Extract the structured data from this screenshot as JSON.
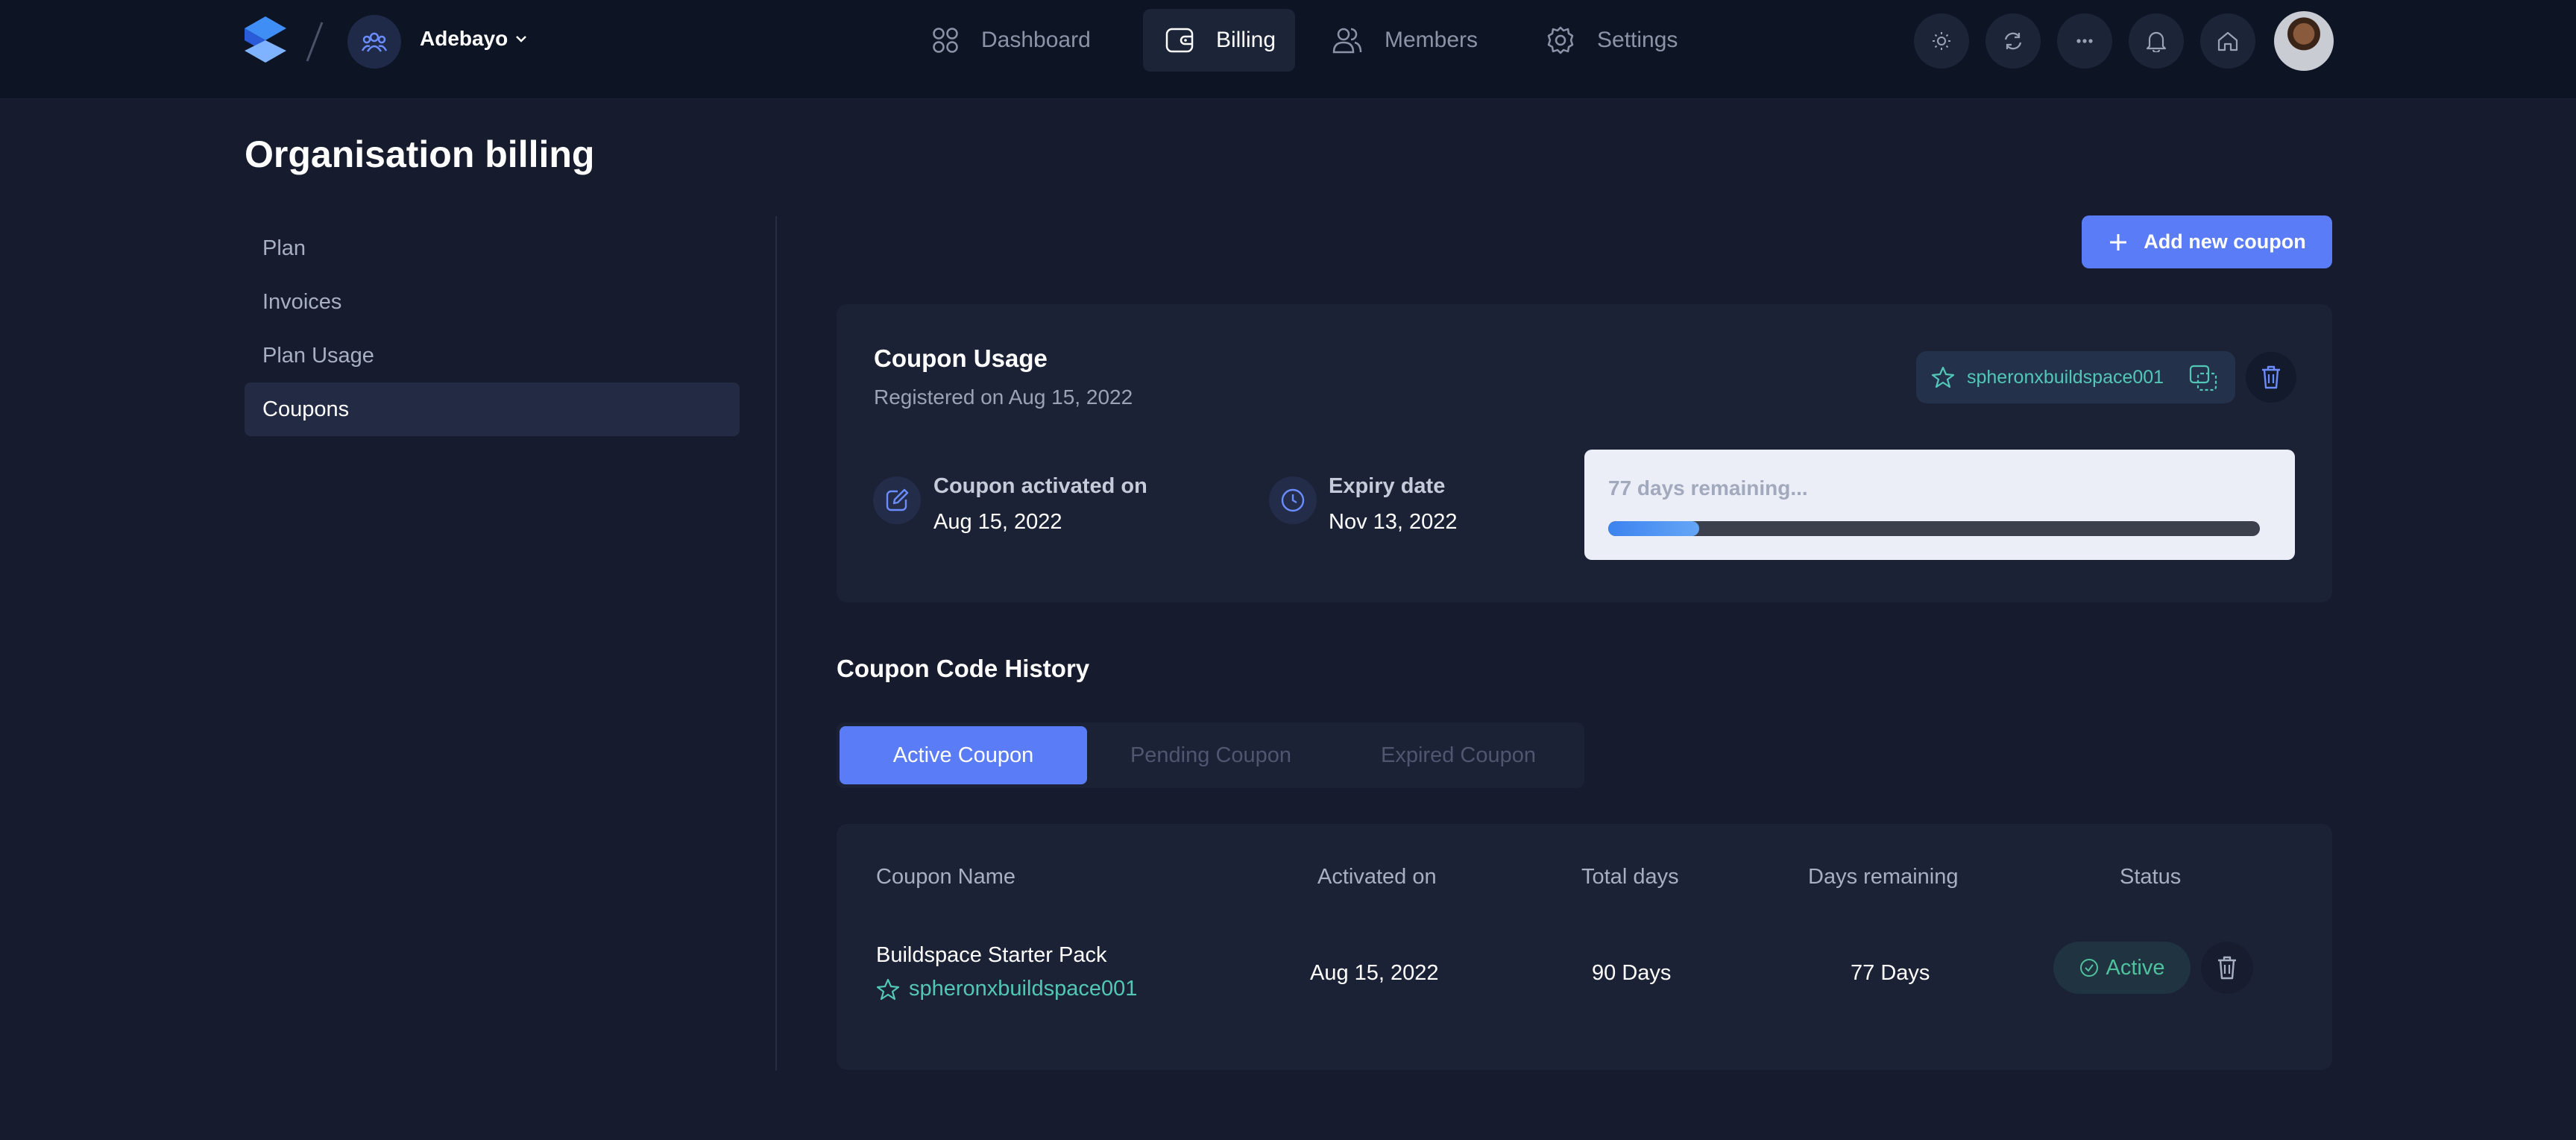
{
  "header": {
    "org_name": "Adebayo",
    "nav": [
      {
        "label": "Dashboard",
        "icon": "grid-icon"
      },
      {
        "label": "Billing",
        "icon": "wallet-icon"
      },
      {
        "label": "Members",
        "icon": "users-icon"
      },
      {
        "label": "Settings",
        "icon": "gear-icon"
      }
    ],
    "actions": [
      "sun-icon",
      "refresh-icon",
      "more-icon",
      "bell-icon",
      "home-icon"
    ]
  },
  "page": {
    "title": "Organisation billing"
  },
  "sidebar": {
    "items": [
      {
        "label": "Plan"
      },
      {
        "label": "Invoices"
      },
      {
        "label": "Plan Usage"
      },
      {
        "label": "Coupons"
      }
    ],
    "active": "Coupons"
  },
  "add_coupon_button": "Add new coupon",
  "coupon_usage": {
    "title": "Coupon Usage",
    "registered": "Registered on Aug 15, 2022",
    "code": "spheronxbuildspace001",
    "activated_label": "Coupon activated on",
    "activated_value": "Aug 15, 2022",
    "expiry_label": "Expiry date",
    "expiry_value": "Nov 13, 2022",
    "remaining_text": "77 days remaining...",
    "progress_fraction": 0.14
  },
  "history": {
    "title": "Coupon Code History",
    "tabs": [
      {
        "label": "Active Coupon"
      },
      {
        "label": "Pending Coupon"
      },
      {
        "label": "Expired Coupon"
      }
    ],
    "columns": [
      "Coupon Name",
      "Activated on",
      "Total days",
      "Days remaining",
      "Status"
    ],
    "rows": [
      {
        "name": "Buildspace Starter Pack",
        "code": "spheronxbuildspace001",
        "activated": "Aug 15, 2022",
        "total_days": "90 Days",
        "days_remaining": "77 Days",
        "status": "Active"
      }
    ]
  },
  "colors": {
    "accent": "#5b7cf7",
    "teal": "#52c7b8",
    "status_active": "#4fc29d",
    "background": "#161b2e"
  }
}
